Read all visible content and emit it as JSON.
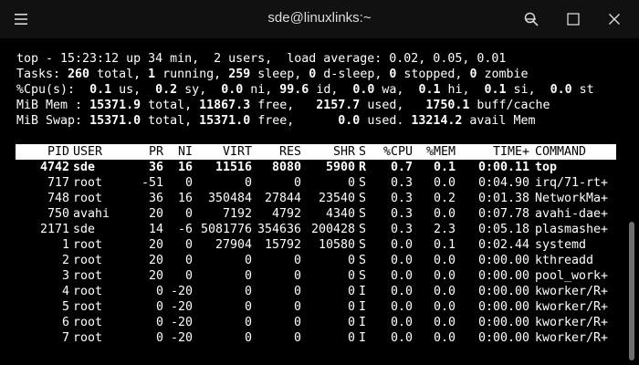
{
  "window": {
    "title": "sde@linuxlinks:~"
  },
  "summary": {
    "line1": "top - 15:23:12 up 34 min,  2 users,  load average: 0.02, 0.05, 0.01",
    "tasks": {
      "label": "Tasks: ",
      "total": "260",
      "total_label": " total, ",
      "running": "1",
      "running_label": " running, ",
      "sleeping": "259",
      "sleeping_label": " sleep, ",
      "dsleep": "0",
      "dsleep_label": " d-sleep, ",
      "stopped": "0",
      "stopped_label": " stopped, ",
      "zombie": "0",
      "zombie_label": " zombie"
    },
    "cpu": {
      "label": "%Cpu(s):  ",
      "us": "0.1",
      "us_label": " us,  ",
      "sy": "0.2",
      "sy_label": " sy,  ",
      "ni": "0.0",
      "ni_label": " ni, ",
      "id": "99.6",
      "id_label": " id,  ",
      "wa": "0.0",
      "wa_label": " wa,  ",
      "hi": "0.1",
      "hi_label": " hi,  ",
      "si": "0.1",
      "si_label": " si,  ",
      "st": "0.0",
      "st_label": " st"
    },
    "mem": {
      "label": "MiB Mem : ",
      "total": "15371.9",
      "total_label": " total, ",
      "free": "11867.3",
      "free_label": " free,   ",
      "used": "2157.7",
      "used_label": " used,   ",
      "buff": "1750.1",
      "buff_label": " buff/cache"
    },
    "swap": {
      "label": "MiB Swap: ",
      "total": "15371.0",
      "total_label": " total, ",
      "free": "15371.0",
      "free_label": " free,      ",
      "used": "0.0",
      "used_label": " used. ",
      "avail": "13214.2",
      "avail_label": " avail Mem"
    }
  },
  "table": {
    "headers": [
      "PID",
      "USER",
      "PR",
      "NI",
      "VIRT",
      "RES",
      "SHR",
      "S",
      "%CPU",
      "%MEM",
      "TIME+",
      "COMMAND"
    ],
    "rows": [
      [
        "4742",
        "sde",
        "36",
        "16",
        "11516",
        "8080",
        "5900",
        "R",
        "0.7",
        "0.1",
        "0:00.11",
        "top"
      ],
      [
        "717",
        "root",
        "-51",
        "0",
        "0",
        "0",
        "0",
        "S",
        "0.3",
        "0.0",
        "0:04.90",
        "irq/71-rt+"
      ],
      [
        "748",
        "root",
        "36",
        "16",
        "350484",
        "27844",
        "23540",
        "S",
        "0.3",
        "0.2",
        "0:01.38",
        "NetworkMa+"
      ],
      [
        "750",
        "avahi",
        "20",
        "0",
        "7192",
        "4792",
        "4340",
        "S",
        "0.3",
        "0.0",
        "0:07.78",
        "avahi-dae+"
      ],
      [
        "2171",
        "sde",
        "14",
        "-6",
        "5081776",
        "354636",
        "200428",
        "S",
        "0.3",
        "2.3",
        "0:05.18",
        "plasmashe+"
      ],
      [
        "1",
        "root",
        "20",
        "0",
        "27904",
        "15792",
        "10580",
        "S",
        "0.0",
        "0.1",
        "0:02.44",
        "systemd"
      ],
      [
        "2",
        "root",
        "20",
        "0",
        "0",
        "0",
        "0",
        "S",
        "0.0",
        "0.0",
        "0:00.00",
        "kthreadd"
      ],
      [
        "3",
        "root",
        "20",
        "0",
        "0",
        "0",
        "0",
        "S",
        "0.0",
        "0.0",
        "0:00.00",
        "pool_work+"
      ],
      [
        "4",
        "root",
        "0",
        "-20",
        "0",
        "0",
        "0",
        "I",
        "0.0",
        "0.0",
        "0:00.00",
        "kworker/R+"
      ],
      [
        "5",
        "root",
        "0",
        "-20",
        "0",
        "0",
        "0",
        "I",
        "0.0",
        "0.0",
        "0:00.00",
        "kworker/R+"
      ],
      [
        "6",
        "root",
        "0",
        "-20",
        "0",
        "0",
        "0",
        "I",
        "0.0",
        "0.0",
        "0:00.00",
        "kworker/R+"
      ],
      [
        "7",
        "root",
        "0",
        "-20",
        "0",
        "0",
        "0",
        "I",
        "0.0",
        "0.0",
        "0:00.00",
        "kworker/R+"
      ]
    ]
  },
  "icons": {
    "menu": "hamburger-menu-icon",
    "search": "search-icon",
    "minimize": "minimize-icon",
    "maximize": "maximize-icon",
    "close": "close-icon"
  }
}
